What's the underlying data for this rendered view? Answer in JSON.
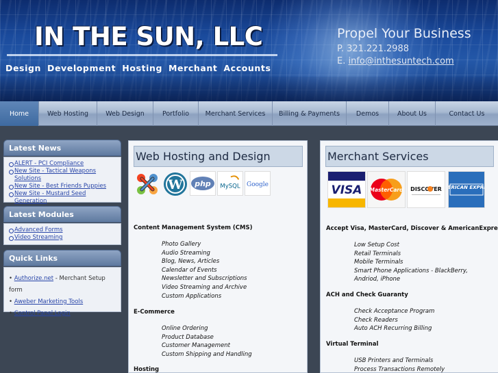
{
  "header": {
    "company": "IN THE SUN, LLC",
    "tagline": "Design  Development  Hosting   Merchant Accounts",
    "propel": "Propel Your Business",
    "phone": "P. 321.221.2988",
    "email_prefix": "E. ",
    "email": "info@inthesuntech.com"
  },
  "nav": {
    "items": [
      {
        "label": "Home",
        "active": true
      },
      {
        "label": "Web Hosting"
      },
      {
        "label": "Web Design"
      },
      {
        "label": "Portfolio"
      },
      {
        "label": "Merchant Services"
      },
      {
        "label": "Billing & Payments"
      },
      {
        "label": "Demos"
      },
      {
        "label": "About Us"
      },
      {
        "label": "Contact Us"
      }
    ]
  },
  "sidebar": {
    "news": {
      "title": "Latest News",
      "items": [
        "ALERT - PCI Compliance",
        "New Site - Tactical Weapons",
        "Solutions",
        "New Site - Best Friends Puppies",
        "New Site - Mustard Seed Generation"
      ]
    },
    "modules": {
      "title": "Latest Modules",
      "items": [
        "Advanced Forms",
        "Video Streaming"
      ]
    },
    "quick": {
      "title": "Quick Links",
      "authorize_link": "Authorize.net",
      "authorize_suffix": " - Merchant Setup form",
      "aweber": "Aweber Marketing Tools",
      "control_panel": "Control Panel Login"
    }
  },
  "hosting": {
    "title": "Web Hosting and Design",
    "logos": [
      "joomla-logo",
      "wordpress-logo",
      "php-logo",
      "mysql-logo",
      "google-logo"
    ],
    "logo_text": {
      "php": "php",
      "mysql": "MySQL",
      "google": "Google"
    },
    "cms_heading": "Content Management System (CMS)",
    "cms_items": [
      "Photo Gallery",
      "Audio Streaming",
      "Blog, News, Articles",
      "Calendar of Events",
      "Newsletter and Subscriptions",
      "Video Streaming and Archive",
      "Custom Applications"
    ],
    "ecommerce_heading": "E-Commerce",
    "ecommerce_items": [
      "Online Ordering",
      "Product Database",
      "Customer Management",
      "Custom Shipping and Handling"
    ],
    "hosting_heading": "Hosting"
  },
  "merchant": {
    "title": "Merchant Services",
    "card_text": {
      "visa": "VISA",
      "mastercard": "MasterCard",
      "discover": "DISCOVER",
      "amex": "AMERICAN EXPRESS"
    },
    "accept_heading": "Accept Visa, MasterCard, Discover & AmericanExpress",
    "accept_items": [
      "Low Setup Cost",
      "Retail Terminals",
      "Mobile Terminals",
      "Smart Phone Applications - BlackBerry,",
      "Andriod, iPhone"
    ],
    "ach_heading": "ACH and Check Guaranty",
    "ach_items": [
      "Check Acceptance Program",
      "Check Readers",
      "Auto ACH Recurring Billing"
    ],
    "virtual_heading": "Virtual Terminal",
    "virtual_items": [
      "USB Printers and Terminals",
      "Process Transactions Remotely"
    ]
  },
  "colors": {
    "nav_active": "#4a76ab",
    "link": "#2845a8",
    "panel_title_bg": "#ccd8e6",
    "sidebar_head": "#6f88ac"
  }
}
